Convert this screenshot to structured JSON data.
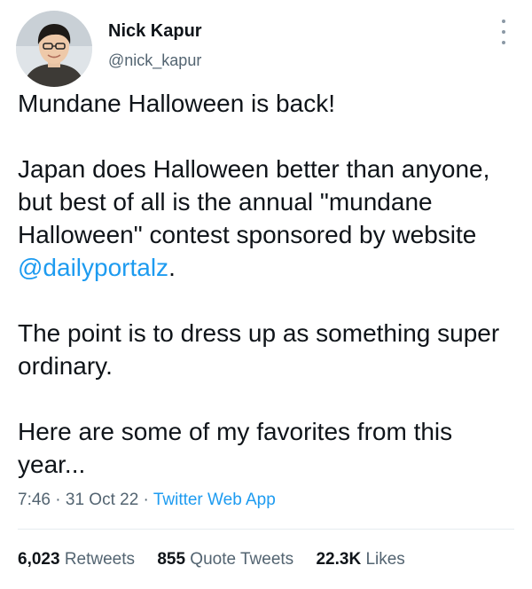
{
  "author": {
    "name": "Nick Kapur",
    "handle": "@nick_kapur",
    "avatar_icon": "profile-photo"
  },
  "more_icon": "vertical-ellipsis-icon",
  "body": {
    "line1": "Mundane Halloween is back!",
    "para2_text": "Japan does Halloween better than anyone, but best of all is the annual \"mundane Halloween\" contest sponsored by website ",
    "para2_mention": "@dailyportalz",
    "para2_end": ".",
    "para3": "The point is to dress up as something super ordinary.",
    "para4": "Here are some of my favorites from this year..."
  },
  "meta": {
    "time": "7:46",
    "date": "31 Oct 22",
    "separator": "·",
    "source": "Twitter Web App"
  },
  "stats": {
    "retweets_count": "6,023",
    "retweets_label": "Retweets",
    "quotes_count": "855",
    "quotes_label": "Quote Tweets",
    "likes_count": "22.3K",
    "likes_label": "Likes"
  },
  "colors": {
    "link": "#1d9bf0",
    "text": "#0f1419",
    "secondary": "#536471",
    "divider": "#e6ecf0"
  }
}
